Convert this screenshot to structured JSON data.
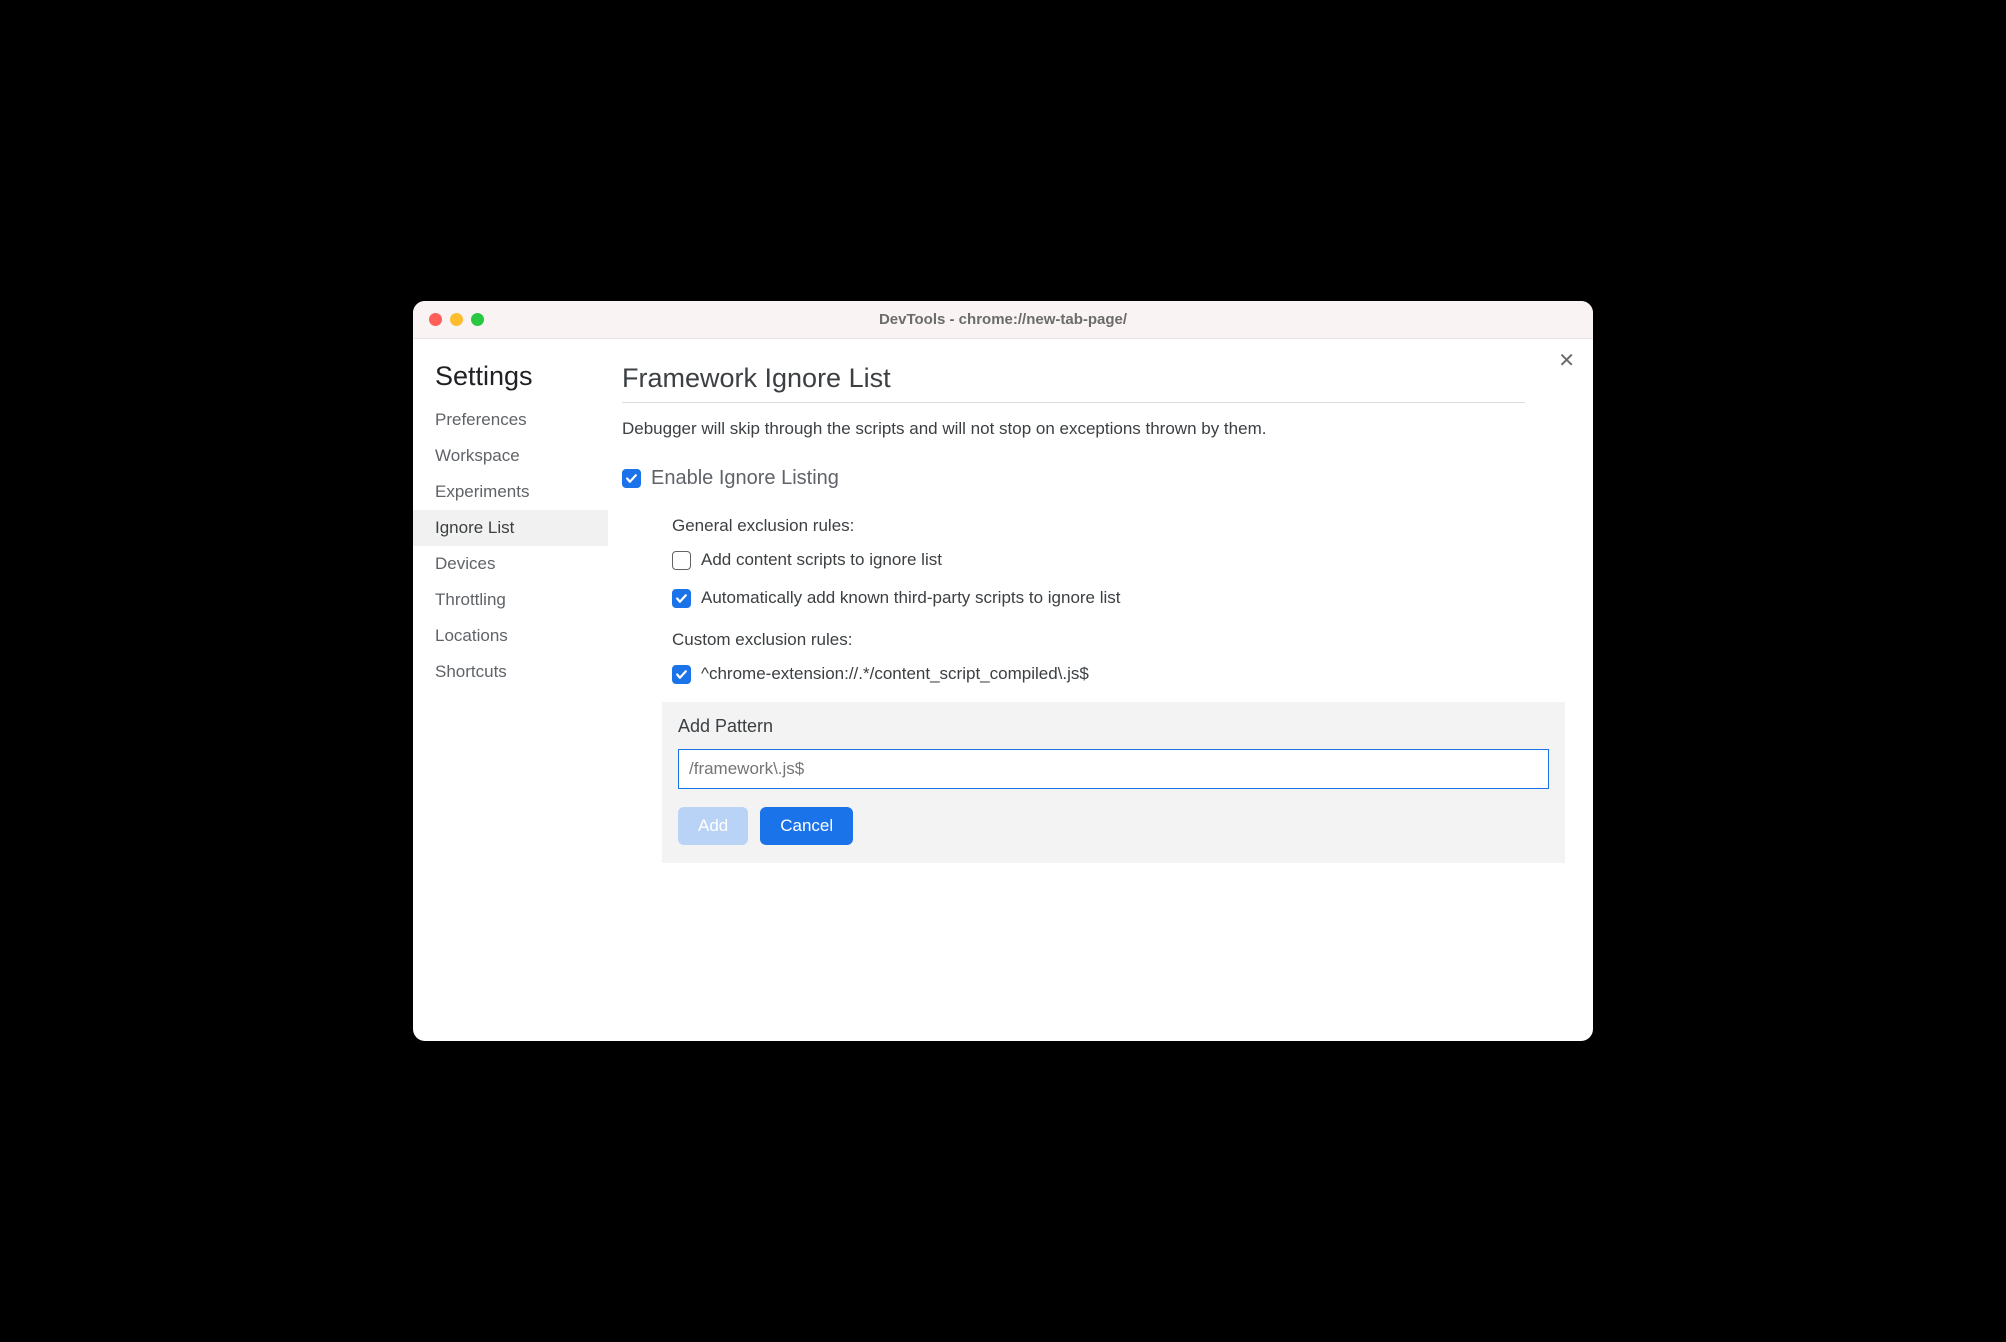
{
  "window": {
    "title": "DevTools - chrome://new-tab-page/"
  },
  "sidebar": {
    "title": "Settings",
    "items": [
      {
        "label": "Preferences",
        "active": false
      },
      {
        "label": "Workspace",
        "active": false
      },
      {
        "label": "Experiments",
        "active": false
      },
      {
        "label": "Ignore List",
        "active": true
      },
      {
        "label": "Devices",
        "active": false
      },
      {
        "label": "Throttling",
        "active": false
      },
      {
        "label": "Locations",
        "active": false
      },
      {
        "label": "Shortcuts",
        "active": false
      }
    ]
  },
  "main": {
    "title": "Framework Ignore List",
    "description": "Debugger will skip through the scripts and will not stop on exceptions thrown by them.",
    "enable_label": "Enable Ignore Listing",
    "enable_checked": true,
    "general_title": "General exclusion rules:",
    "general_rules": [
      {
        "label": "Add content scripts to ignore list",
        "checked": false
      },
      {
        "label": "Automatically add known third-party scripts to ignore list",
        "checked": true
      }
    ],
    "custom_title": "Custom exclusion rules:",
    "custom_rules": [
      {
        "label": "^chrome-extension://.*/content_script_compiled\\.js$",
        "checked": true
      }
    ],
    "add_pattern": {
      "title": "Add Pattern",
      "placeholder": "/framework\\.js$",
      "value": "",
      "add_button": "Add",
      "cancel_button": "Cancel"
    }
  }
}
